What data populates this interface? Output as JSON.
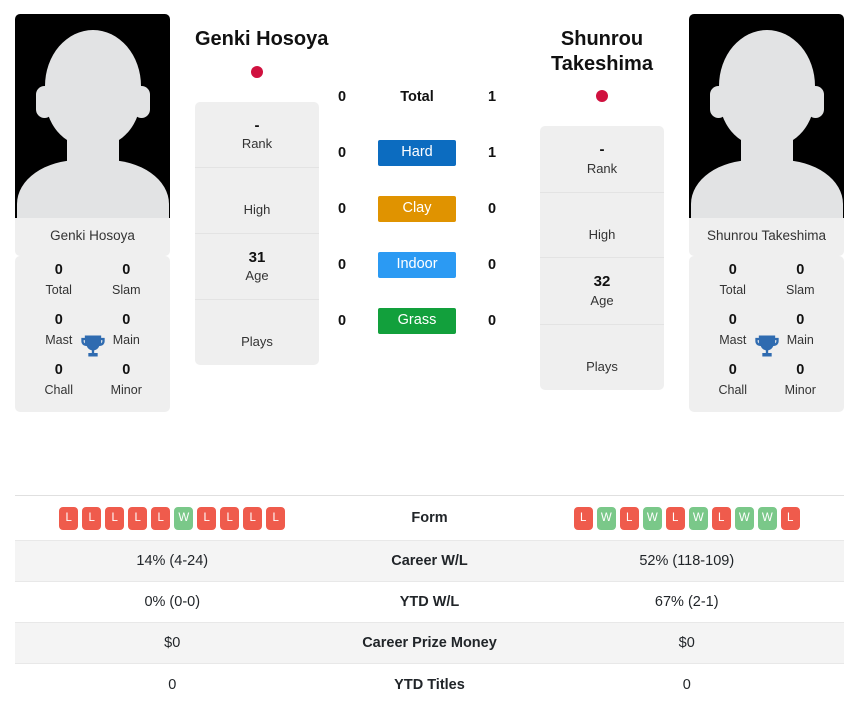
{
  "colors": {
    "hard": "#0c6cc0",
    "clay": "#e09300",
    "indoor": "#2b9af3",
    "grass": "#12a03c",
    "win": "#7ac889",
    "loss": "#ef5b4c",
    "flag_dot": "#d0113f",
    "trophy": "#2f6bb0",
    "card_bg": "#efefef"
  },
  "left_player": {
    "name": "Genki Hosoya",
    "avatar_caption": "Genki Hosoya",
    "country_flag": "japan-flag-dot",
    "titles": [
      {
        "num": "0",
        "label": "Total"
      },
      {
        "num": "0",
        "label": "Slam"
      },
      {
        "num": "0",
        "label": "Mast"
      },
      {
        "num": "0",
        "label": "Main"
      },
      {
        "num": "0",
        "label": "Chall"
      },
      {
        "num": "0",
        "label": "Minor"
      }
    ],
    "info": [
      {
        "value": "-",
        "key": "Rank"
      },
      {
        "value": "",
        "key": "High"
      },
      {
        "value": "31",
        "key": "Age"
      },
      {
        "value": "",
        "key": "Plays"
      }
    ],
    "form": [
      "L",
      "L",
      "L",
      "L",
      "L",
      "W",
      "L",
      "L",
      "L",
      "L"
    ]
  },
  "right_player": {
    "name": "Shunrou Takeshima",
    "avatar_caption": "Shunrou Takeshima",
    "country_flag": "japan-flag-dot",
    "titles": [
      {
        "num": "0",
        "label": "Total"
      },
      {
        "num": "0",
        "label": "Slam"
      },
      {
        "num": "0",
        "label": "Mast"
      },
      {
        "num": "0",
        "label": "Main"
      },
      {
        "num": "0",
        "label": "Chall"
      },
      {
        "num": "0",
        "label": "Minor"
      }
    ],
    "info": [
      {
        "value": "-",
        "key": "Rank"
      },
      {
        "value": "",
        "key": "High"
      },
      {
        "value": "32",
        "key": "Age"
      },
      {
        "value": "",
        "key": "Plays"
      }
    ],
    "form": [
      "L",
      "W",
      "L",
      "W",
      "L",
      "W",
      "L",
      "W",
      "W",
      "L"
    ]
  },
  "head_to_head": [
    {
      "left": "0",
      "label": "Total",
      "right": "1",
      "surface": false
    },
    {
      "left": "0",
      "label": "Hard",
      "right": "1",
      "surface": true,
      "color_key": "hard"
    },
    {
      "left": "0",
      "label": "Clay",
      "right": "0",
      "surface": true,
      "color_key": "clay"
    },
    {
      "left": "0",
      "label": "Indoor",
      "right": "0",
      "surface": true,
      "color_key": "indoor"
    },
    {
      "left": "0",
      "label": "Grass",
      "right": "0",
      "surface": true,
      "color_key": "grass"
    }
  ],
  "stats_table": {
    "form_label": "Form",
    "rows": [
      {
        "left": "14% (4-24)",
        "label": "Career W/L",
        "right": "52% (118-109)"
      },
      {
        "left": "0% (0-0)",
        "label": "YTD W/L",
        "right": "67% (2-1)"
      },
      {
        "left": "$0",
        "label": "Career Prize Money",
        "right": "$0"
      },
      {
        "left": "0",
        "label": "YTD Titles",
        "right": "0"
      }
    ]
  }
}
